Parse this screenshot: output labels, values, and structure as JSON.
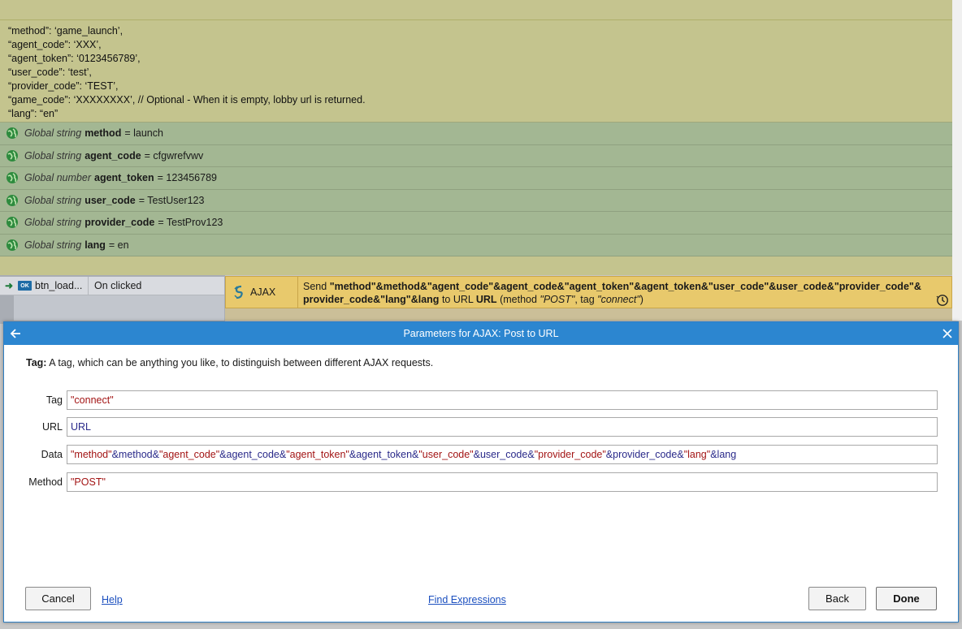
{
  "comment": {
    "lines": [
      "“method”: ‘game_launch’,",
      "“agent_code”: ‘XXX’,",
      "“agent_token”: ‘0123456789’,",
      "“user_code”: ‘test’,",
      "“provider_code”: ‘TEST’,",
      "“game_code”: ‘XXXXXXXX’, // Optional - When it is empty, lobby url is returned.",
      "“lang”: “en”"
    ]
  },
  "globals": [
    {
      "kind": "Global string",
      "name": "method",
      "value": "= launch"
    },
    {
      "kind": "Global string",
      "name": "agent_code",
      "value": "= cfgwrefvwv"
    },
    {
      "kind": "Global number",
      "name": "agent_token",
      "value": "= 123456789"
    },
    {
      "kind": "Global string",
      "name": "user_code",
      "value": "= TestUser123"
    },
    {
      "kind": "Global string",
      "name": "provider_code",
      "value": "= TestProv123"
    },
    {
      "kind": "Global string",
      "name": "lang",
      "value": "= en"
    }
  ],
  "event": {
    "condition": {
      "icon_text": "OK",
      "object": "btn_load...",
      "trigger": "On clicked"
    },
    "action": {
      "object": "AJAX",
      "send_word": "Send",
      "expression_line1": "\"method\"&method&\"agent_code\"&agent_code&\"agent_token\"&agent_token&\"user_code\"&user_code&\"provider_code\"&",
      "expression_line2": "provider_code&\"lang\"&lang",
      "to_url": "to URL",
      "url_word": "URL",
      "method_prefix": "(method",
      "method_value": "\"POST\"",
      "tag_prefix": ", tag",
      "tag_value": "\"connect\"",
      "suffix": ")"
    }
  },
  "dialog": {
    "title": "Parameters for AJAX: Post to URL",
    "description_label": "Tag:",
    "description_text": "A tag, which can be anything you like, to distinguish between different AJAX requests.",
    "fields": {
      "tag": {
        "label": "Tag",
        "value": "\"connect\""
      },
      "url": {
        "label": "URL",
        "value": "URL"
      },
      "data": {
        "label": "Data",
        "tokens": [
          {
            "t": "\"method\"",
            "s": true
          },
          {
            "t": "&method&",
            "s": false
          },
          {
            "t": "\"agent_code\"",
            "s": true
          },
          {
            "t": "&agent_code&",
            "s": false
          },
          {
            "t": "\"agent_token\"",
            "s": true
          },
          {
            "t": "&agent_token&",
            "s": false
          },
          {
            "t": "\"user_code\"",
            "s": true
          },
          {
            "t": "&user_code&",
            "s": false
          },
          {
            "t": "\"provider_code\"",
            "s": true
          },
          {
            "t": "&provider_code&",
            "s": false
          },
          {
            "t": "\"lang\"",
            "s": true
          },
          {
            "t": "&lang",
            "s": false
          }
        ]
      },
      "method": {
        "label": "Method",
        "value": "\"POST\""
      }
    },
    "buttons": {
      "cancel": "Cancel",
      "help": "Help",
      "find": "Find Expressions",
      "back": "Back",
      "done": "Done"
    }
  },
  "colors": {
    "titlebar": "#2c86d0",
    "string_literal": "#a31515",
    "identifier": "#2a2a8a",
    "action_bg": "#e8c96c"
  }
}
